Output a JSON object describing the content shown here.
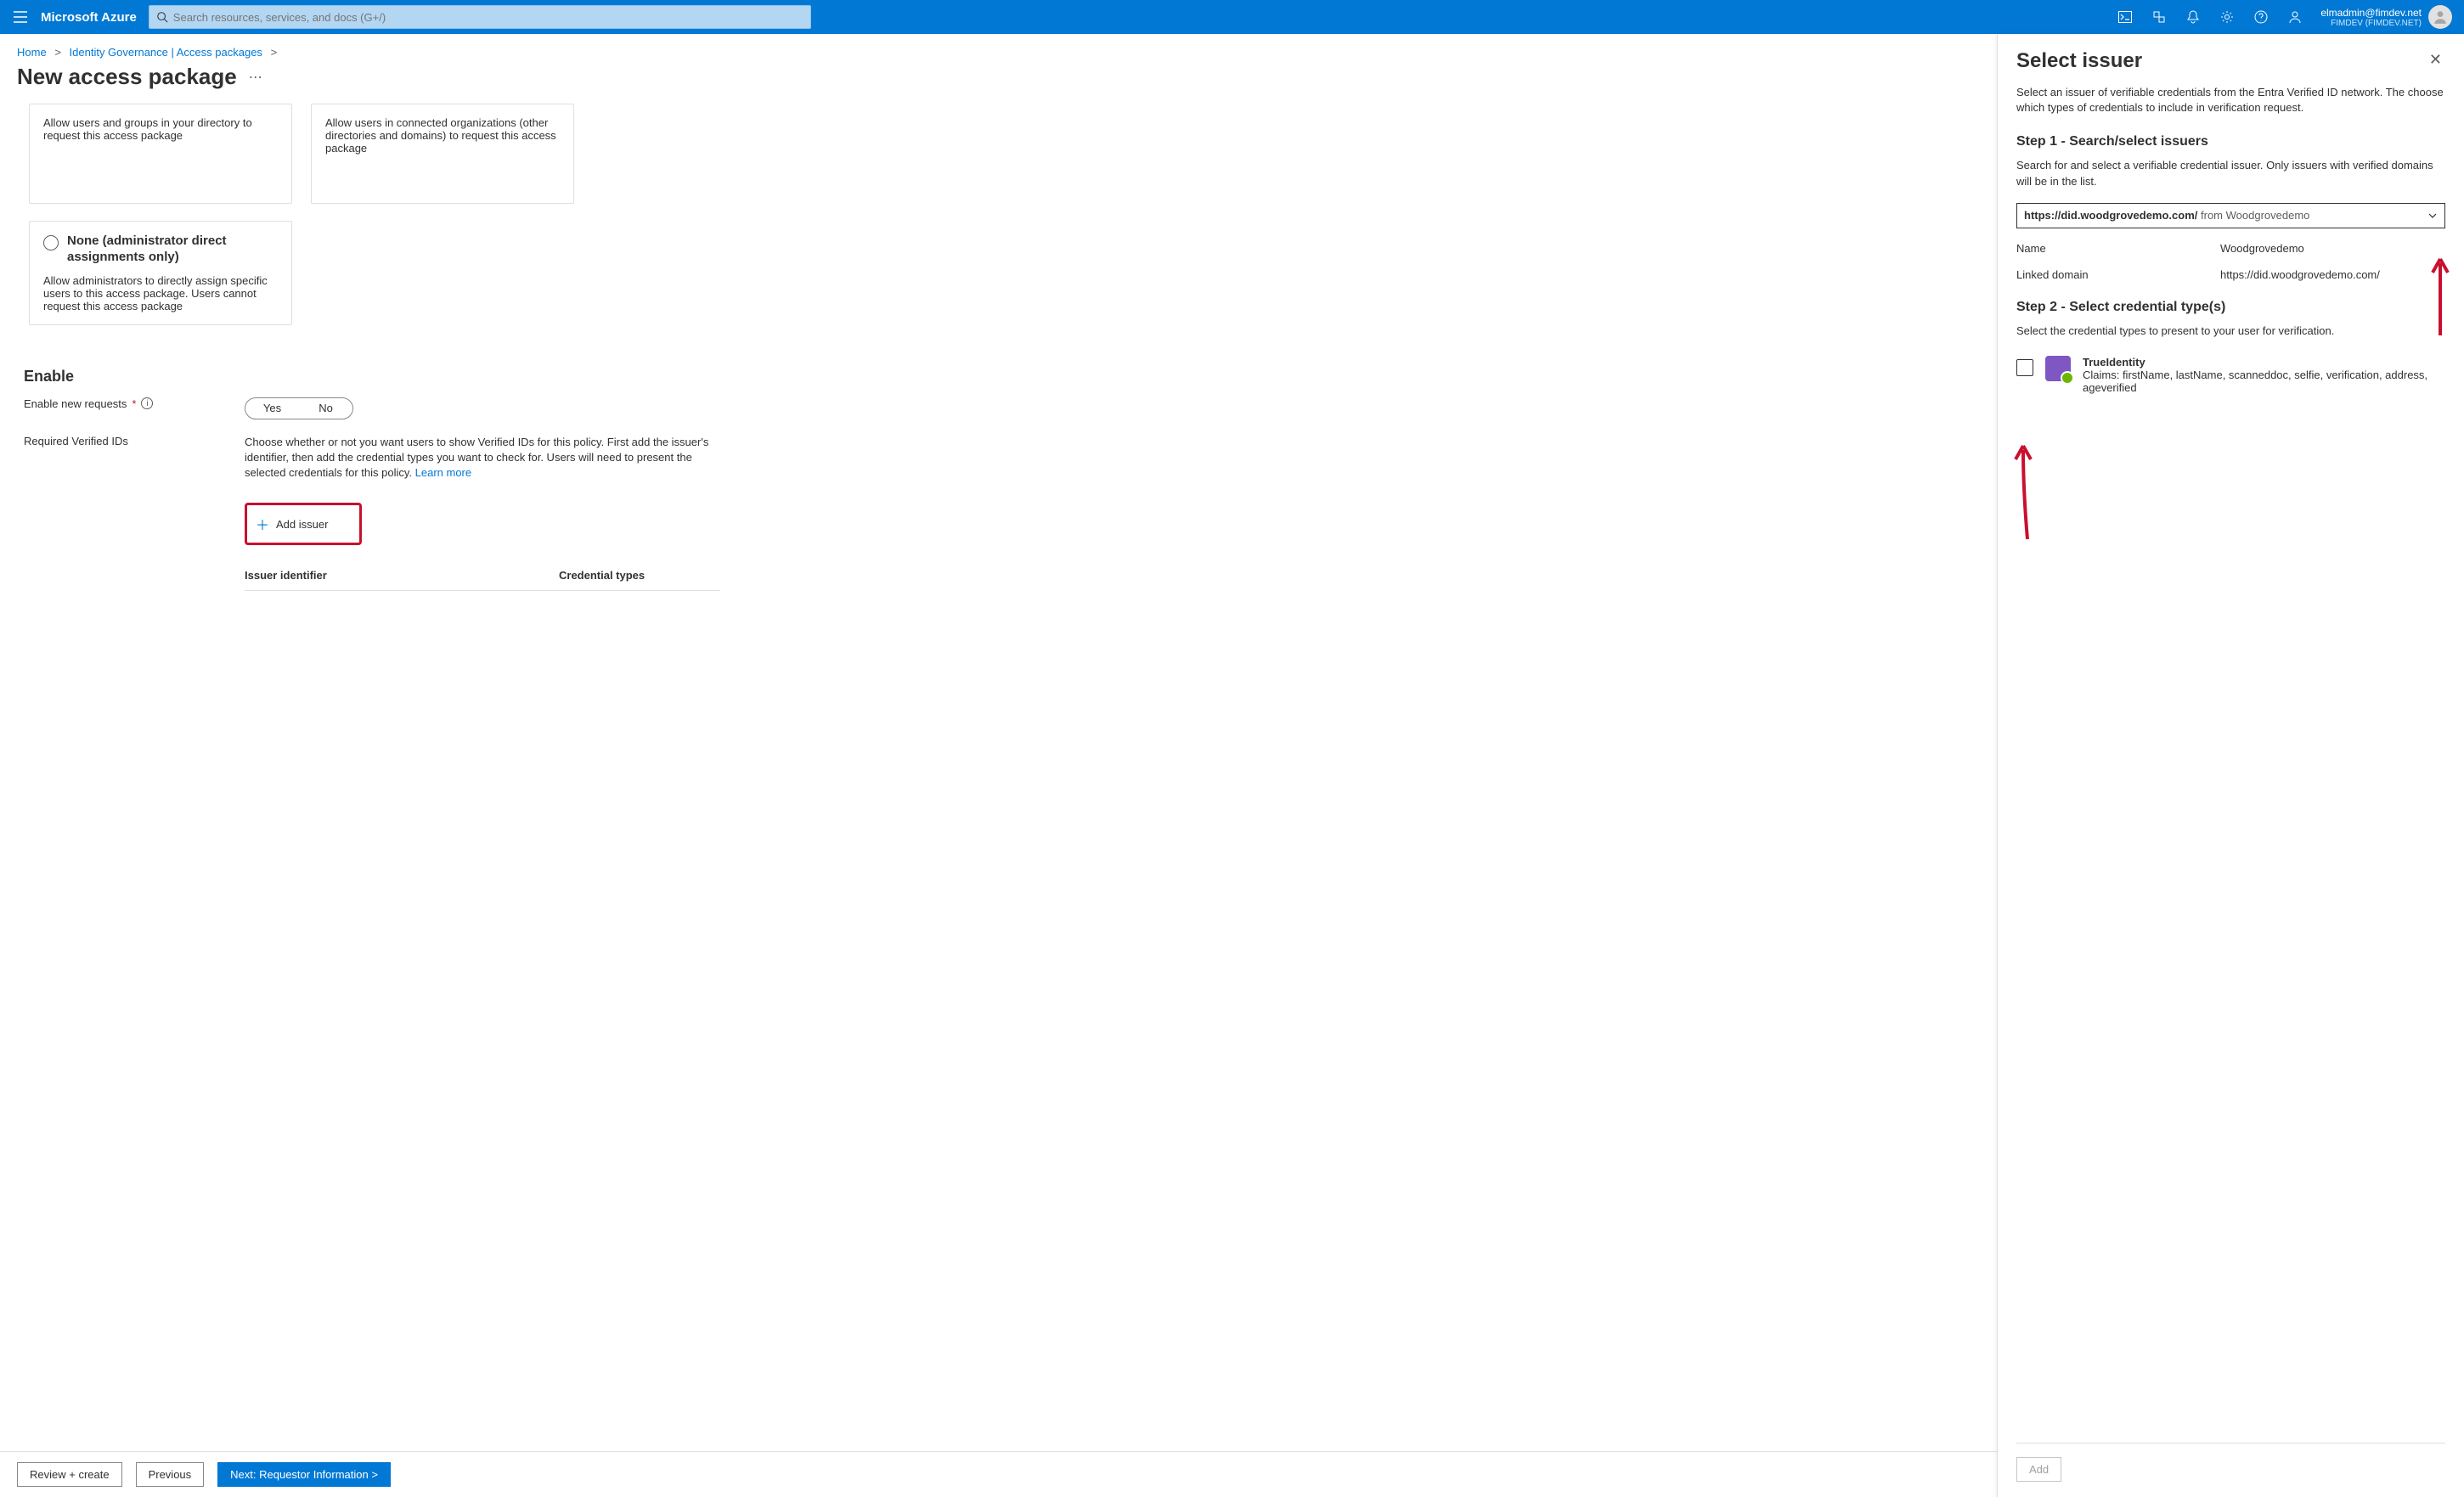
{
  "topbar": {
    "brand": "Microsoft Azure",
    "search_placeholder": "Search resources, services, and docs (G+/)",
    "account_email": "elmadmin@fimdev.net",
    "account_tenant": "FIMDEV (FIMDEV.NET)"
  },
  "breadcrumb": {
    "items": [
      "Home",
      "Identity Governance | Access packages"
    ]
  },
  "page_title": "New access package",
  "cards": {
    "card1_desc": "Allow users and groups in your directory to request this access package",
    "card2_desc": "Allow users in connected organizations (other directories and domains) to request this access package",
    "card3_title": "None (administrator direct assignments only)",
    "card3_desc": "Allow administrators to directly assign specific users to this access package. Users cannot request this access package"
  },
  "enable": {
    "section_title": "Enable",
    "row1_label": "Enable new requests",
    "toggle_yes": "Yes",
    "toggle_no": "No",
    "row2_label": "Required Verified IDs",
    "row2_desc_1": "Choose whether or not you want users to show Verified IDs for this policy. First add the issuer's identifier, then add the credential types you want to check for. Users will need to present the selected credentials for this policy. ",
    "row2_learn": "Learn more",
    "add_issuer": "Add issuer",
    "col_id": "Issuer identifier",
    "col_type": "Credential types"
  },
  "bottom": {
    "review": "Review + create",
    "previous": "Previous",
    "next": "Next: Requestor Information >"
  },
  "panel": {
    "title": "Select issuer",
    "desc": "Select an issuer of verifiable credentials from the Entra Verified ID network. The choose which types of credentials to include in verification request.",
    "step1_title": "Step 1 - Search/select issuers",
    "step1_desc": "Search for and select a verifiable credential issuer. Only issuers with verified domains will be in the list.",
    "dropdown_bold": "https://did.woodgrovedemo.com/",
    "dropdown_from": "from",
    "dropdown_org": "Woodgrovedemo",
    "name_label": "Name",
    "name_value": "Woodgrovedemo",
    "linked_label": "Linked domain",
    "linked_value": "https://did.woodgrovedemo.com/",
    "step2_title": "Step 2 - Select credential type(s)",
    "step2_desc": "Select the credential types to present to your user for verification.",
    "cred_name": "TrueIdentity",
    "cred_claims": "Claims: firstName, lastName, scanneddoc, selfie, verification, address, ageverified",
    "add_btn": "Add"
  }
}
